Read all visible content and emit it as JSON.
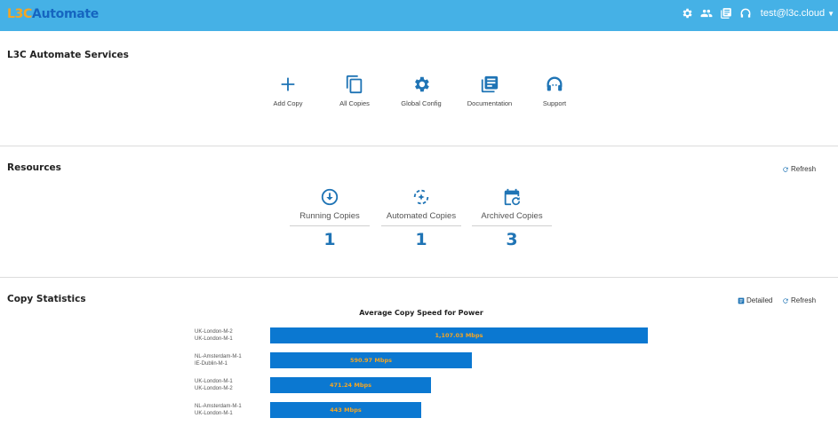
{
  "header": {
    "brand_part1": "L3C",
    "brand_part2": "Automate",
    "icons": [
      "gear-icon",
      "users-icon",
      "library-books-icon",
      "headset-icon"
    ],
    "user": "test@l3c.cloud"
  },
  "services": {
    "title": "L3C Automate Services",
    "items": [
      {
        "label": "Add Copy",
        "icon": "plus-icon"
      },
      {
        "label": "All Copies",
        "icon": "copy-icon"
      },
      {
        "label": "Global Config",
        "icon": "gear-icon"
      },
      {
        "label": "Documentation",
        "icon": "library-books-icon"
      },
      {
        "label": "Support",
        "icon": "headset-icon"
      }
    ]
  },
  "resources": {
    "title": "Resources",
    "refresh_label": "Refresh",
    "items": [
      {
        "label": "Running Copies",
        "count": "1",
        "icon": "download-circle-icon"
      },
      {
        "label": "Automated Copies",
        "count": "1",
        "icon": "auto-refresh-icon"
      },
      {
        "label": "Archived Copies",
        "count": "3",
        "icon": "calendar-refresh-icon"
      }
    ]
  },
  "statistics": {
    "title": "Copy Statistics",
    "detailed_label": "Detailed",
    "refresh_label": "Refresh"
  },
  "colors": {
    "header": "#45b1e6",
    "accent": "#1f74b5",
    "bar": "#0b78d1",
    "bar_label": "#f5a623"
  },
  "chart_data": {
    "type": "bar",
    "orientation": "horizontal",
    "title": "Average Copy Speed for Power",
    "categories": [
      [
        "UK-London-M-2",
        "UK-London-M-1"
      ],
      [
        "NL-Amsterdam-M-1",
        "IE-Dublin-M-1"
      ],
      [
        "UK-London-M-1",
        "UK-London-M-2"
      ],
      [
        "NL-Amsterdam-M-1",
        "UK-London-M-1"
      ]
    ],
    "values": [
      1107.03,
      590.97,
      471.24,
      443
    ],
    "value_labels": [
      "1,107.03 Mbps",
      "590.97 Mbps",
      "471.24 Mbps",
      "443 Mbps"
    ],
    "unit": "Mbps",
    "xlim": [
      0,
      1107.03
    ],
    "grid": false,
    "legend": "none"
  }
}
